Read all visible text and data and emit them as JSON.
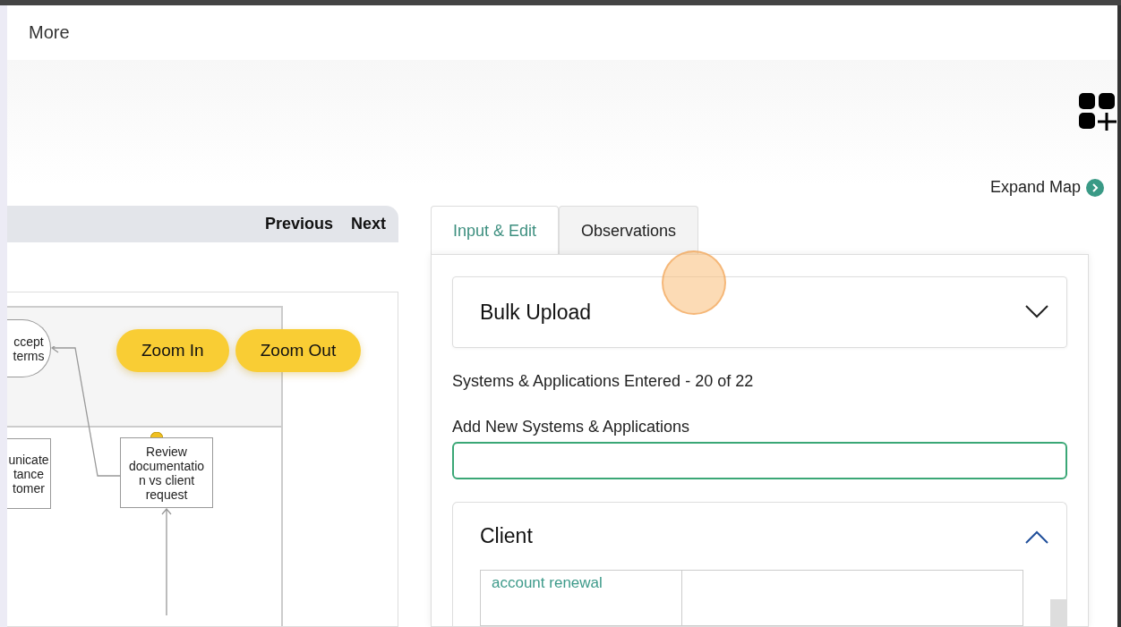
{
  "top_bar": {
    "menu_item": "More"
  },
  "expand_map": {
    "label": "Expand Map"
  },
  "map_nav": {
    "buttons": [
      "Previous",
      "Next"
    ]
  },
  "map": {
    "zoom_buttons": [
      "Zoom In",
      "Zoom Out"
    ],
    "nodes": [
      {
        "kind": "terminal",
        "lines": [
          "ccept",
          "terms"
        ]
      },
      {
        "kind": "task",
        "lines": [
          "unicate",
          "tance",
          "tomer"
        ]
      },
      {
        "kind": "task",
        "lines": [
          "Review",
          "documentatio",
          "n vs client",
          "request"
        ]
      }
    ]
  },
  "tabs": [
    {
      "label": "Input & Edit",
      "selected": true
    },
    {
      "label": "Observations",
      "selected": false
    }
  ],
  "bulk_upload": {
    "title": "Bulk Upload",
    "expanded": false
  },
  "summary": "Systems & Applications Entered - 20 of 22",
  "new_entry": {
    "label": "Add New Systems & Applications"
  },
  "client": {
    "title": "Client",
    "expanded": true,
    "rows": [
      {
        "column_1": "account renewal"
      }
    ]
  }
}
